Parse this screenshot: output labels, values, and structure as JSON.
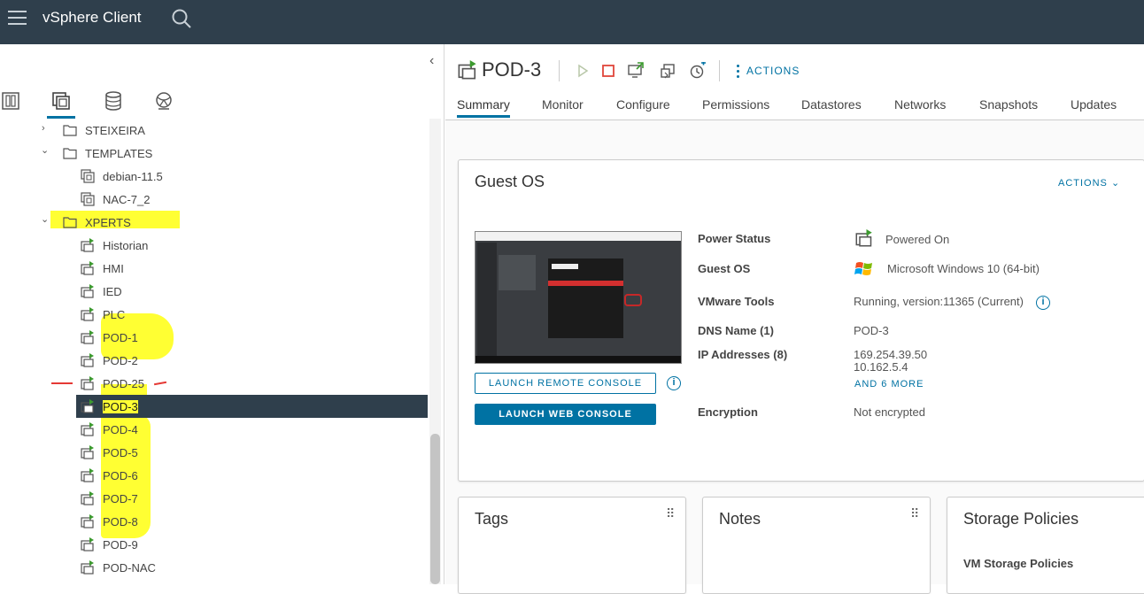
{
  "header": {
    "app_title": "vSphere Client"
  },
  "tree": {
    "rows": [
      {
        "label": "STEIXEIRA",
        "type": "folder",
        "chevron": "›"
      },
      {
        "label": "TEMPLATES",
        "type": "folder",
        "chevron": "⌄"
      },
      {
        "label": "debian-11.5",
        "type": "template"
      },
      {
        "label": "NAC-7_2",
        "type": "template"
      },
      {
        "label": "XPERTS",
        "type": "folder",
        "chevron": "⌄"
      },
      {
        "label": "Historian",
        "type": "vm"
      },
      {
        "label": "HMI",
        "type": "vm"
      },
      {
        "label": "IED",
        "type": "vm"
      },
      {
        "label": "PLC",
        "type": "vm"
      },
      {
        "label": "POD-1",
        "type": "vm"
      },
      {
        "label": "POD-2",
        "type": "vm"
      },
      {
        "label": "POD-25",
        "type": "vm"
      },
      {
        "label": "POD-3",
        "type": "vm",
        "selected": true
      },
      {
        "label": "POD-4",
        "type": "vm"
      },
      {
        "label": "POD-5",
        "type": "vm"
      },
      {
        "label": "POD-6",
        "type": "vm"
      },
      {
        "label": "POD-7",
        "type": "vm"
      },
      {
        "label": "POD-8",
        "type": "vm"
      },
      {
        "label": "POD-9",
        "type": "vm"
      },
      {
        "label": "POD-NAC",
        "type": "vm"
      }
    ]
  },
  "vm": {
    "title": "POD-3",
    "actions_label": "ACTIONS"
  },
  "tabs": [
    "Summary",
    "Monitor",
    "Configure",
    "Permissions",
    "Datastores",
    "Networks",
    "Snapshots",
    "Updates"
  ],
  "guest_os": {
    "title": "Guest OS",
    "actions_label": "ACTIONS",
    "launch_remote": "LAUNCH REMOTE CONSOLE",
    "launch_web": "LAUNCH WEB CONSOLE",
    "props": {
      "power_status_label": "Power Status",
      "power_status_value": "Powered On",
      "guest_os_label": "Guest OS",
      "guest_os_value": "Microsoft Windows 10 (64-bit)",
      "vmware_tools_label": "VMware Tools",
      "vmware_tools_value": "Running, version:11365 (Current)",
      "dns_label": "DNS Name (1)",
      "dns_value": "POD-3",
      "ip_label": "IP Addresses (8)",
      "ip_value_1": "169.254.39.50",
      "ip_value_2": "10.162.5.4",
      "ip_more": "AND 6 MORE",
      "encryption_label": "Encryption",
      "encryption_value": "Not encrypted"
    }
  },
  "bottom_cards": {
    "tags_title": "Tags",
    "notes_title": "Notes",
    "storage_title": "Storage Policies",
    "storage_sub": "VM Storage Policies"
  },
  "colors": {
    "header_bg": "#2f3f4c",
    "accent": "#0072a3",
    "highlight": "#ffff33",
    "stop_red": "#e0453a"
  }
}
